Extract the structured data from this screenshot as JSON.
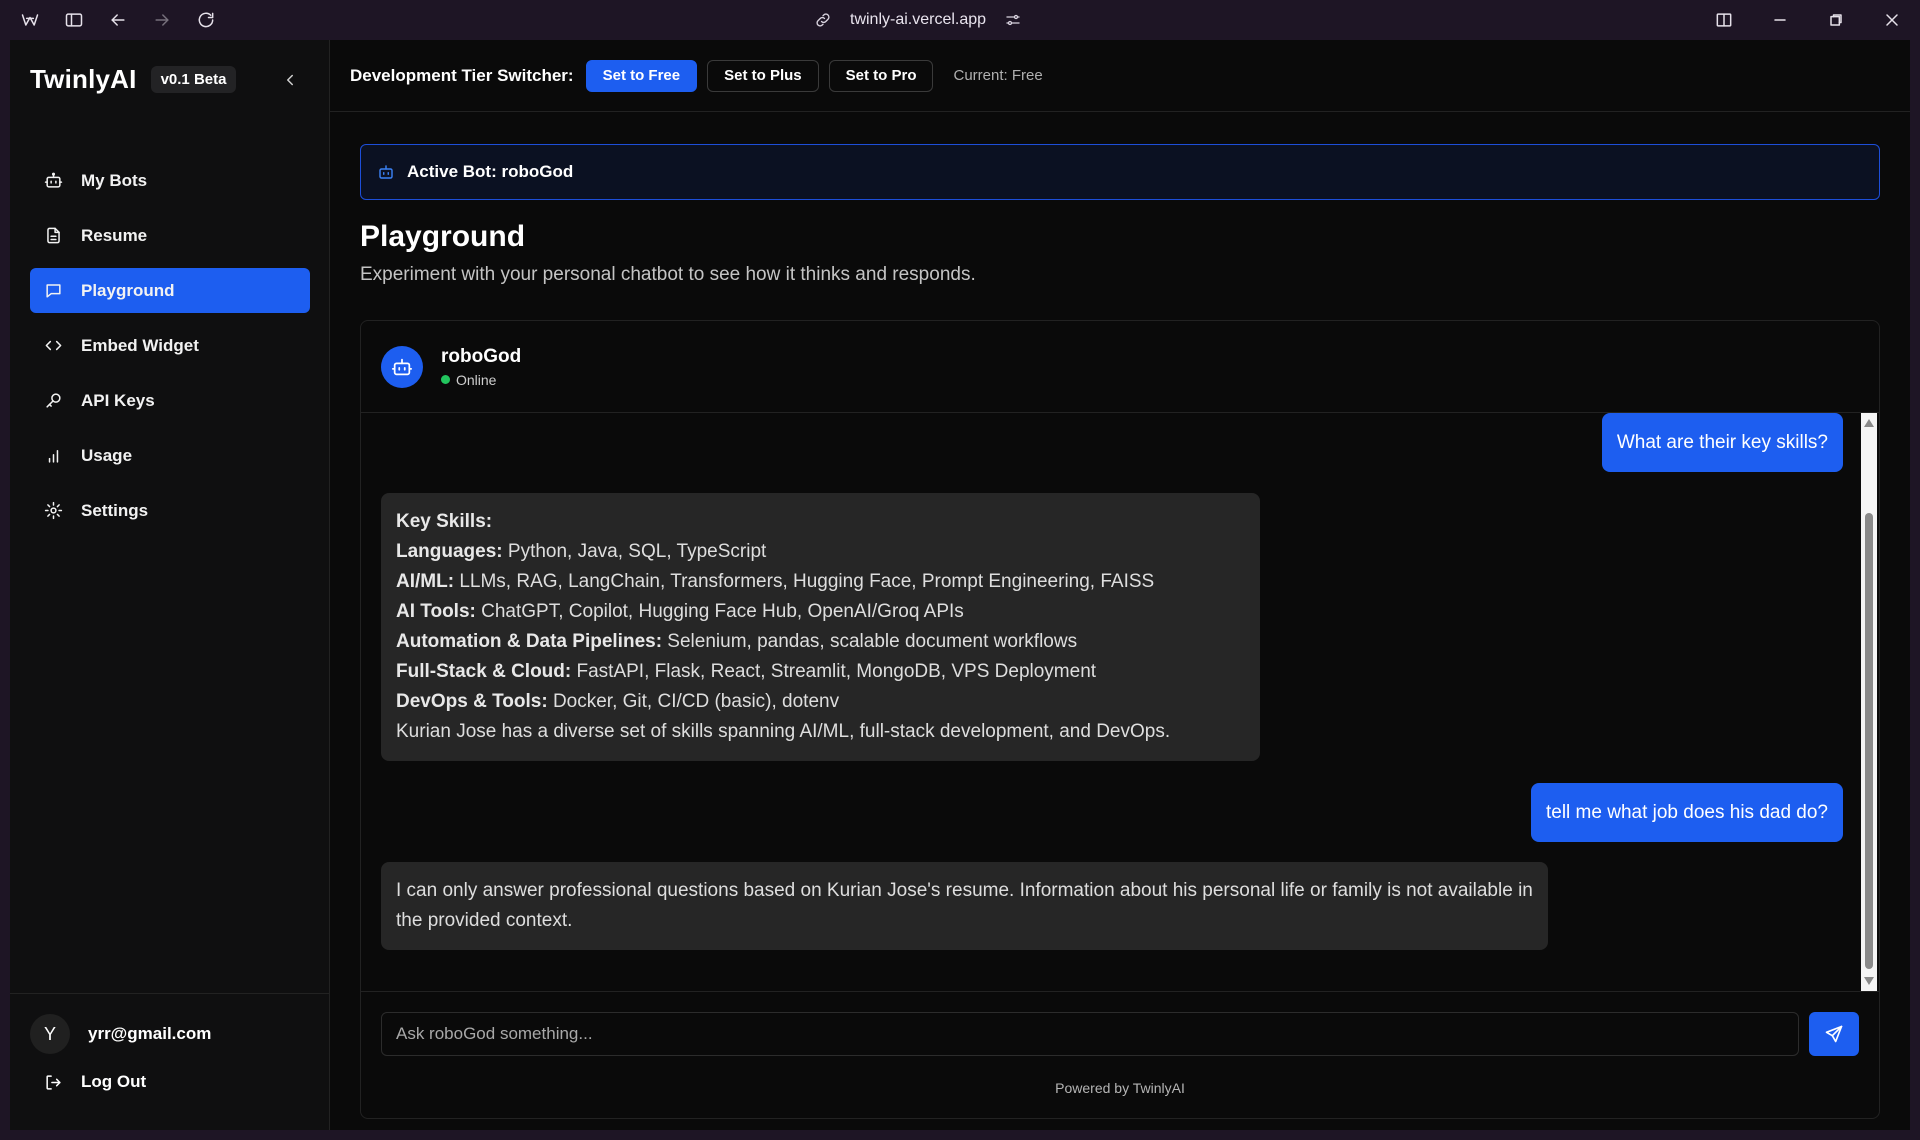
{
  "browser": {
    "url": "twinly-ai.vercel.app"
  },
  "sidebar": {
    "brand": "TwinlyAI",
    "version": "v0.1 Beta",
    "items": [
      {
        "label": "My Bots",
        "icon": "bot-icon"
      },
      {
        "label": "Resume",
        "icon": "document-icon"
      },
      {
        "label": "Playground",
        "icon": "chat-icon",
        "active": true
      },
      {
        "label": "Embed Widget",
        "icon": "code-icon"
      },
      {
        "label": "API Keys",
        "icon": "key-icon"
      },
      {
        "label": "Usage",
        "icon": "bar-chart-icon"
      },
      {
        "label": "Settings",
        "icon": "gear-icon"
      }
    ],
    "user": {
      "initial": "Y",
      "email": "yrr@gmail.com"
    },
    "logout_label": "Log Out"
  },
  "tierbar": {
    "label": "Development Tier Switcher:",
    "buttons": [
      "Set to Free",
      "Set to Plus",
      "Set to Pro"
    ],
    "current": "Current: Free"
  },
  "active_bot": "Active Bot: roboGod",
  "page": {
    "title": "Playground",
    "subtitle": "Experiment with your personal chatbot to see how it thinks and responds."
  },
  "chat": {
    "bot_name": "roboGod",
    "status": "Online",
    "messages": {
      "q1": "What are their key skills?",
      "a1": {
        "heading": "Key Skills:",
        "lines": [
          {
            "label": "Languages:",
            "text": " Python, Java, SQL, TypeScript"
          },
          {
            "label": "AI/ML:",
            "text": " LLMs, RAG, LangChain, Transformers, Hugging Face, Prompt Engineering, FAISS"
          },
          {
            "label": "AI Tools:",
            "text": " ChatGPT, Copilot, Hugging Face Hub, OpenAI/Groq APIs"
          },
          {
            "label": "Automation & Data Pipelines:",
            "text": " Selenium, pandas, scalable document workflows"
          },
          {
            "label": "Full-Stack & Cloud:",
            "text": " FastAPI, Flask, React, Streamlit, MongoDB, VPS Deployment"
          },
          {
            "label": "DevOps & Tools:",
            "text": " Docker, Git, CI/CD (basic), dotenv"
          }
        ],
        "summary": "Kurian Jose has a diverse set of skills spanning AI/ML, full-stack development, and DevOps."
      },
      "q2": "tell me what job does his dad do?",
      "a2": "I can only answer professional questions based on Kurian Jose's resume. Information about his personal life or family is not available in the provided context."
    },
    "input_placeholder": "Ask roboGod something...",
    "powered_by": "Powered by TwinlyAI"
  },
  "colors": {
    "accent": "#1d5ef0",
    "online": "#22c55e"
  }
}
